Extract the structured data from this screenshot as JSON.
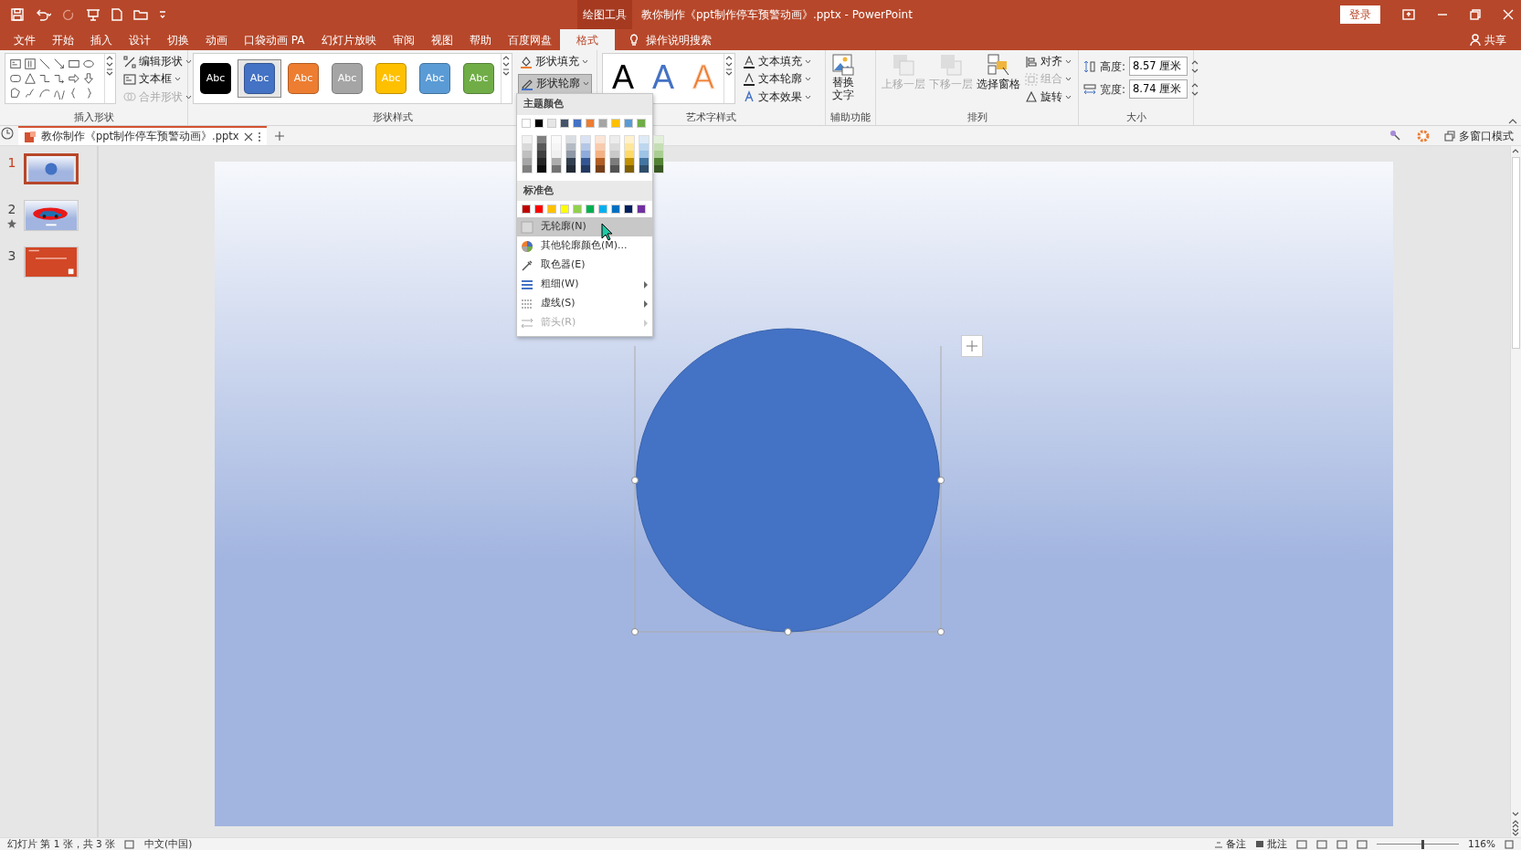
{
  "title_bar": {
    "context_group": "绘图工具",
    "title": "教你制作《ppt制作停车预警动画》.pptx  -  PowerPoint",
    "login": "登录"
  },
  "ribbon_tabs": [
    {
      "label": "文件",
      "selected": false
    },
    {
      "label": "开始",
      "selected": false
    },
    {
      "label": "插入",
      "selected": false
    },
    {
      "label": "设计",
      "selected": false
    },
    {
      "label": "切换",
      "selected": false
    },
    {
      "label": "动画",
      "selected": false
    },
    {
      "label": "口袋动画 PA",
      "selected": false
    },
    {
      "label": "幻灯片放映",
      "selected": false
    },
    {
      "label": "审阅",
      "selected": false
    },
    {
      "label": "视图",
      "selected": false
    },
    {
      "label": "帮助",
      "selected": false
    },
    {
      "label": "百度网盘",
      "selected": false
    },
    {
      "label": "格式",
      "selected": true
    }
  ],
  "tell_me": "操作说明搜索",
  "share": "共享",
  "ribbon": {
    "insert_shapes": {
      "label": "插入形状",
      "commands": [
        {
          "label": "编辑形状",
          "disabled": false
        },
        {
          "label": "文本框",
          "disabled": false
        },
        {
          "label": "合并形状",
          "disabled": true
        }
      ]
    },
    "shape_styles": {
      "label": "形状样式",
      "styles": [
        {
          "text": "Abc",
          "color": "#000000",
          "selected": false
        },
        {
          "text": "Abc",
          "color": "#4472c4",
          "selected": true
        },
        {
          "text": "Abc",
          "color": "#ed7d31",
          "selected": false
        },
        {
          "text": "Abc",
          "color": "#a5a5a5",
          "selected": false
        },
        {
          "text": "Abc",
          "color": "#ffc000",
          "selected": false
        },
        {
          "text": "Abc",
          "color": "#5b9bd5",
          "selected": false
        },
        {
          "text": "Abc",
          "color": "#70ad47",
          "selected": false
        }
      ],
      "commands": [
        {
          "label": "形状填充",
          "open": false
        },
        {
          "label": "形状轮廓",
          "open": true
        }
      ]
    },
    "wordart": {
      "label": "艺术字样式",
      "samples": [
        {
          "text": "A",
          "kind": "fill",
          "color": "#000000"
        },
        {
          "text": "A",
          "kind": "fill",
          "color": "#4472c4"
        },
        {
          "text": "A",
          "kind": "outline",
          "color": "#ed7d31"
        }
      ],
      "commands": [
        {
          "label": "文本填充"
        },
        {
          "label": "文本轮廓"
        },
        {
          "label": "文本效果"
        }
      ]
    },
    "accessibility": {
      "label": "辅助功能",
      "command": "替换文字"
    },
    "arrange": {
      "label": "排列",
      "large": [
        {
          "label": "上移一层",
          "disabled": true
        },
        {
          "label": "下移一层",
          "disabled": true
        },
        {
          "label": "选择窗格",
          "disabled": false
        }
      ],
      "small": [
        {
          "label": "对齐",
          "disabled": false
        },
        {
          "label": "组合",
          "disabled": true
        },
        {
          "label": "旋转",
          "disabled": false
        }
      ]
    },
    "size": {
      "label": "大小",
      "fields": [
        {
          "label": "高度:",
          "value": "8.57 厘米"
        },
        {
          "label": "宽度:",
          "value": "8.74 厘米"
        }
      ]
    }
  },
  "document_tab": {
    "title": "教你制作《ppt制作停车预警动画》.pptx"
  },
  "multi_window": "多窗口模式",
  "slides": [
    {
      "number": "1",
      "selected": true,
      "kind": "circle",
      "animated": false
    },
    {
      "number": "2",
      "selected": false,
      "kind": "car",
      "animated": true
    },
    {
      "number": "3",
      "selected": false,
      "kind": "title",
      "animated": false
    }
  ],
  "outline_menu": {
    "theme_label": "主题颜色",
    "theme_colors": [
      {
        "color": "#ffffff"
      },
      {
        "color": "#000000"
      },
      {
        "color": "#e7e6e6"
      },
      {
        "color": "#44546a"
      },
      {
        "color": "#4472c4"
      },
      {
        "color": "#ed7d31"
      },
      {
        "color": "#a5a5a5"
      },
      {
        "color": "#ffc000"
      },
      {
        "color": "#5b9bd5"
      },
      {
        "color": "#70ad47"
      }
    ],
    "standard_label": "标准色",
    "standard_colors": [
      {
        "color": "#c00000"
      },
      {
        "color": "#ff0000"
      },
      {
        "color": "#ffc000"
      },
      {
        "color": "#ffff00"
      },
      {
        "color": "#92d050"
      },
      {
        "color": "#00b050"
      },
      {
        "color": "#00b0f0"
      },
      {
        "color": "#0070c0"
      },
      {
        "color": "#002060"
      },
      {
        "color": "#7030a0"
      }
    ],
    "items": [
      {
        "label": "无轮廓(N)",
        "kind": "none",
        "highlighted": true,
        "disabled": false,
        "submenu": false
      },
      {
        "label": "其他轮廓颜色(M)...",
        "kind": "palette",
        "highlighted": false,
        "disabled": false,
        "submenu": false
      },
      {
        "label": "取色器(E)",
        "kind": "eyedropper",
        "highlighted": false,
        "disabled": false,
        "submenu": false
      },
      {
        "label": "粗细(W)",
        "kind": "weight",
        "highlighted": false,
        "disabled": false,
        "submenu": true
      },
      {
        "label": "虚线(S)",
        "kind": "dash",
        "highlighted": false,
        "disabled": false,
        "submenu": true
      },
      {
        "label": "箭头(R)",
        "kind": "arrow",
        "highlighted": false,
        "disabled": true,
        "submenu": true
      }
    ]
  },
  "status_bar": {
    "slide_info": "幻灯片 第 1 张，共 3 张",
    "language": "中文(中国)",
    "notes": "备注",
    "comments": "批注",
    "zoom_slider": {
      "level": 0.55
    },
    "zoom": "116%"
  }
}
